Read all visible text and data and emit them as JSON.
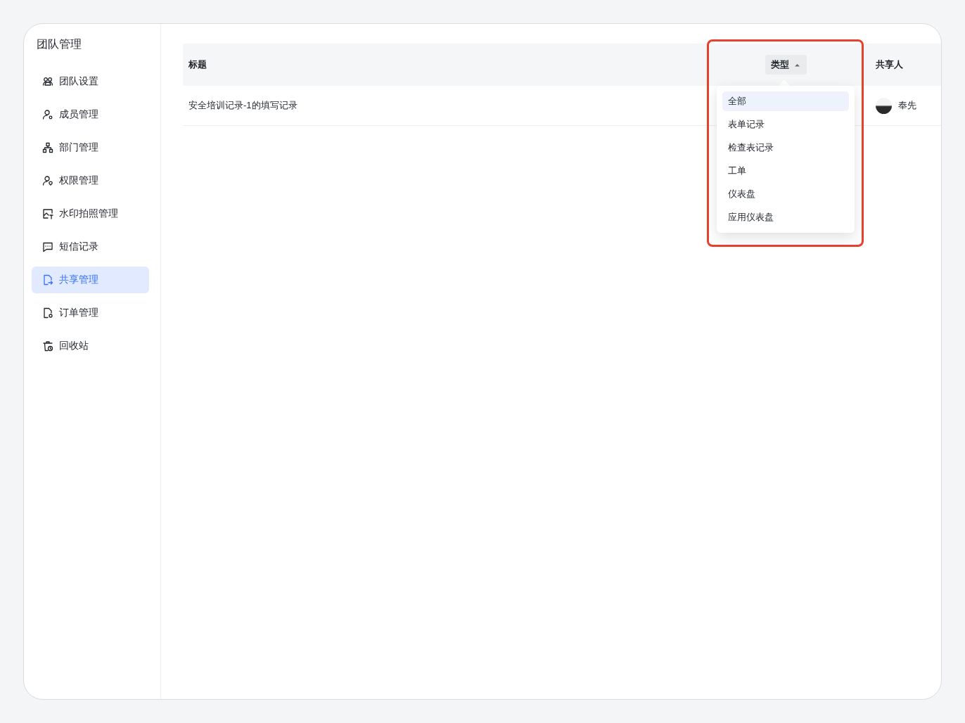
{
  "sidebar": {
    "title": "团队管理",
    "items": [
      {
        "label": "团队设置",
        "selected": false
      },
      {
        "label": "成员管理",
        "selected": false
      },
      {
        "label": "部门管理",
        "selected": false
      },
      {
        "label": "权限管理",
        "selected": false
      },
      {
        "label": "水印拍照管理",
        "selected": false
      },
      {
        "label": "短信记录",
        "selected": false
      },
      {
        "label": "共享管理",
        "selected": true
      },
      {
        "label": "订单管理",
        "selected": false
      },
      {
        "label": "回收站",
        "selected": false
      }
    ]
  },
  "table": {
    "columns": [
      {
        "label": "标题",
        "kind": "text"
      },
      {
        "label": "类型",
        "kind": "filter",
        "open": true
      },
      {
        "label": "共享人",
        "kind": "person"
      }
    ],
    "rows": [
      {
        "title": "安全培训记录-1的填写记录",
        "sharer": "奉先"
      }
    ]
  },
  "type_filter": {
    "options": [
      {
        "label": "全部",
        "selected": true
      },
      {
        "label": "表单记录",
        "selected": false
      },
      {
        "label": "检查表记录",
        "selected": false
      },
      {
        "label": "工单",
        "selected": false
      },
      {
        "label": "仪表盘",
        "selected": false
      },
      {
        "label": "应用仪表盘",
        "selected": false
      }
    ]
  }
}
